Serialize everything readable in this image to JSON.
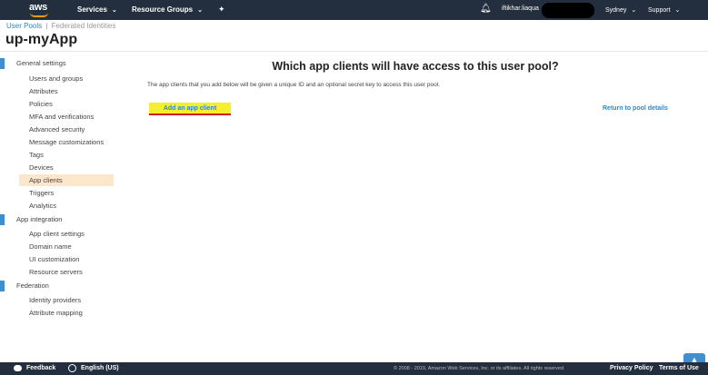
{
  "topnav": {
    "logo": "aws",
    "services": "Services",
    "resource_groups": "Resource Groups",
    "pin_icon": "pin-icon",
    "bell_icon": "bell-icon",
    "username": "iftikhar.liaqua",
    "region": "Sydney",
    "support": "Support"
  },
  "breadcrumb": {
    "user_pools": "User Pools",
    "separator": "|",
    "federated": "Federated Identities"
  },
  "page_title": "up-myApp",
  "sidebar": {
    "sections": [
      {
        "label": "General settings"
      },
      {
        "label": "App integration"
      },
      {
        "label": "Federation"
      }
    ],
    "general": [
      "Users and groups",
      "Attributes",
      "Policies",
      "MFA and verifications",
      "Advanced security",
      "Message customizations",
      "Tags",
      "Devices",
      "App clients",
      "Triggers",
      "Analytics"
    ],
    "app_integration": [
      "App client settings",
      "Domain name",
      "UI customization",
      "Resource servers"
    ],
    "federation": [
      "Identity providers",
      "Attribute mapping"
    ]
  },
  "main": {
    "heading": "Which app clients will have access to this user pool?",
    "description": "The app clients that you add below will be given a unique ID and an optional secret key to access this user pool.",
    "add_button": "Add an app client",
    "return_link": "Return to pool details"
  },
  "footer": {
    "feedback": "Feedback",
    "language": "English (US)",
    "copyright": "© 2008 - 2019, Amazon Web Services, Inc. or its affiliates. All rights reserved.",
    "privacy": "Privacy Policy",
    "terms": "Terms of Use"
  },
  "colors": {
    "nav_bg": "#232f3e",
    "accent_orange": "#ff9900",
    "link_blue": "#2e87c8",
    "section_bar": "#3f8ecf",
    "active_item_bg": "#fde7cc",
    "button_yellow": "#f5ef2e",
    "underline_red": "#d41c1c"
  }
}
